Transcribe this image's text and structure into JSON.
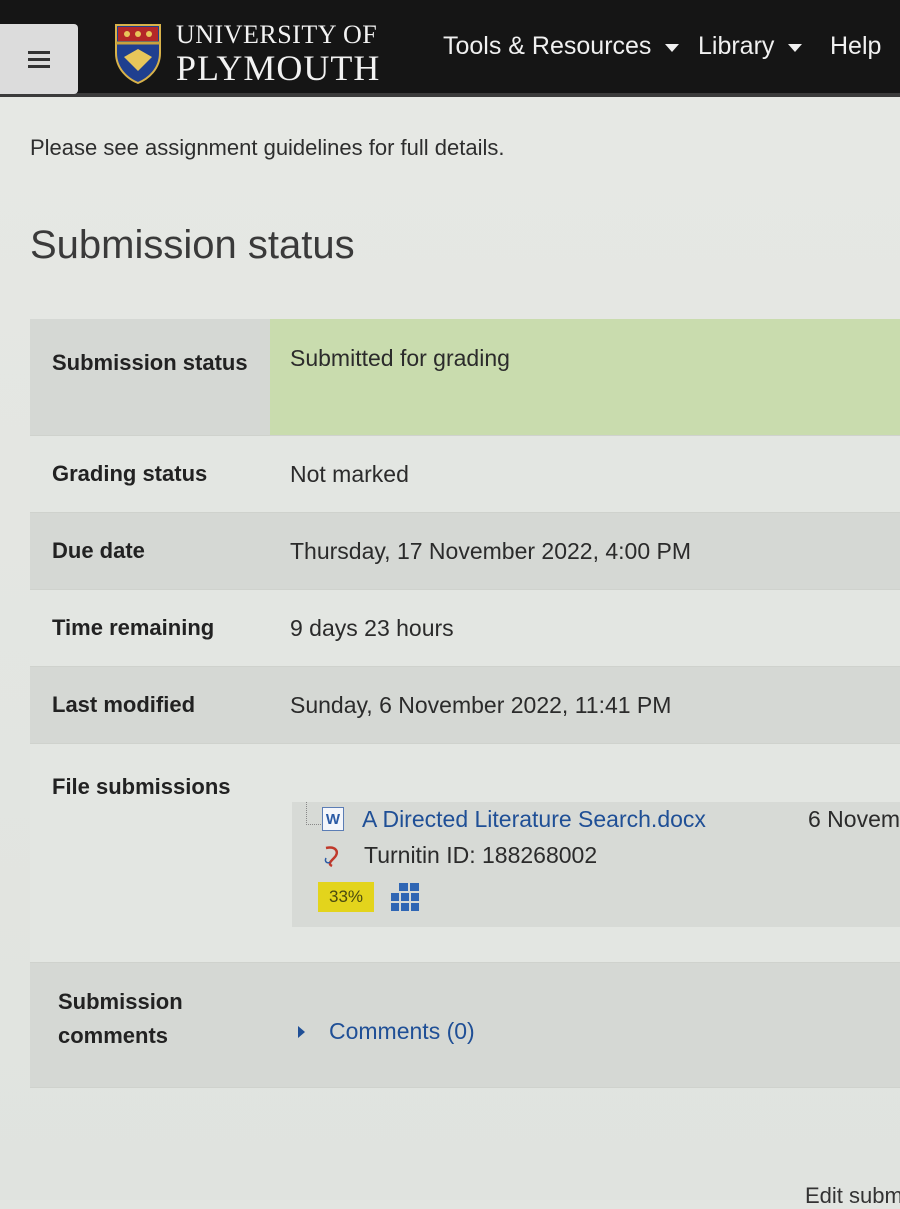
{
  "header": {
    "logo_line1": "UNIVERSITY OF",
    "logo_line2": "PLYMOUTH",
    "nav": [
      {
        "label": "Tools & Resources",
        "has_dropdown": true
      },
      {
        "label": "Library",
        "has_dropdown": true
      },
      {
        "label": "Help",
        "has_dropdown": false
      }
    ],
    "menu_icon": "hamburger-icon"
  },
  "main": {
    "guidelines_text": "Please see assignment guidelines for full details.",
    "section_title": "Submission status",
    "rows": [
      {
        "label": "Submission status",
        "value": "Submitted for grading"
      },
      {
        "label": "Grading status",
        "value": "Not marked"
      },
      {
        "label": "Due date",
        "value": "Thursday, 17 November 2022, 4:00 PM"
      },
      {
        "label": "Time remaining",
        "value": "9 days 23 hours"
      },
      {
        "label": "Last modified",
        "value": "Sunday, 6 November 2022, 11:41 PM"
      },
      {
        "label": "File submissions",
        "value": ""
      },
      {
        "label": "Submission comments",
        "value": ""
      }
    ],
    "file": {
      "name": "A Directed Literature Search.docx",
      "date": "6 Novem",
      "turnitin": "Turnitin ID: 188268002",
      "similarity": "33%"
    },
    "comments_link": "Comments (0)",
    "edit_button": "Edit subm"
  },
  "colors": {
    "navbar": "#151515",
    "submitted_green": "#c9dcae",
    "link_blue": "#1f4f96",
    "similarity_yellow": "#e3d41c"
  }
}
